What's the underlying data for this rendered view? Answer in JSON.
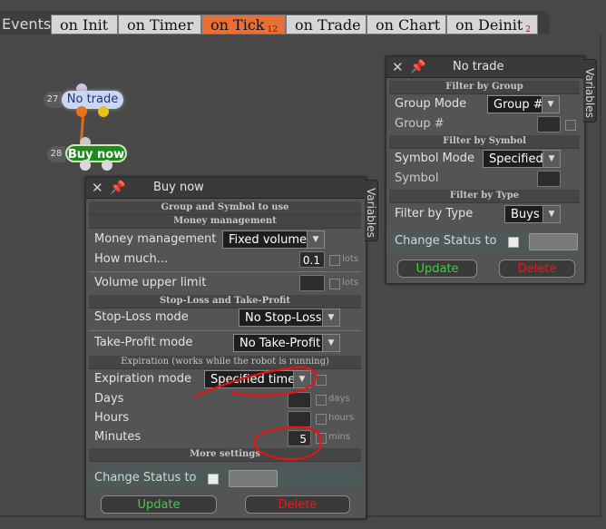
{
  "tabs": {
    "events_label": "Events",
    "items": [
      {
        "label": "on Init",
        "badge": ""
      },
      {
        "label": "on Timer",
        "badge": ""
      },
      {
        "label": "on Tick",
        "badge": "12"
      },
      {
        "label": "on Trade",
        "badge": ""
      },
      {
        "label": "on Chart",
        "badge": ""
      },
      {
        "label": "on Deinit",
        "badge": "2"
      }
    ],
    "active": "on Tick"
  },
  "nodes": [
    {
      "id": "27",
      "label": "No trade"
    },
    {
      "id": "28",
      "label": "Buy now"
    }
  ],
  "buy_panel": {
    "title": "Buy now",
    "variables_tab": "Variables",
    "group_symbol_header": "Group and Symbol to use",
    "money_header": "Money management",
    "money_mode_label": "Money management",
    "money_mode_value": "Fixed volume",
    "how_much_label": "How much...",
    "how_much_value": "0.1",
    "how_much_unit": "lots",
    "vol_upper_label": "Volume upper limit",
    "vol_upper_value": "",
    "vol_upper_unit": "lots",
    "sltp_header": "Stop-Loss and Take-Profit",
    "sl_label": "Stop-Loss mode",
    "sl_value": "No Stop-Loss",
    "tp_label": "Take-Profit mode",
    "tp_value": "No Take-Profit",
    "exp_header": "Expiration (works while the robot is running)",
    "exp_mode_label": "Expiration mode",
    "exp_mode_value": "Specified time",
    "days_label": "Days",
    "days_value": "",
    "days_unit": "days",
    "hours_label": "Hours",
    "hours_value": "",
    "hours_unit": "hours",
    "minutes_label": "Minutes",
    "minutes_value": "5",
    "minutes_unit": "mins",
    "more_header": "More settings",
    "change_status_label": "Change Status to",
    "change_status_value": "",
    "update_label": "Update",
    "delete_label": "Delete"
  },
  "notrade_panel": {
    "title": "No trade",
    "variables_tab": "Variables",
    "filter_group_header": "Filter by Group",
    "group_mode_label": "Group Mode",
    "group_mode_value": "Group #",
    "group_num_label": "Group #",
    "group_num_value": "",
    "filter_symbol_header": "Filter by Symbol",
    "symbol_mode_label": "Symbol Mode",
    "symbol_mode_value": "Specified",
    "symbol_label": "Symbol",
    "symbol_value": "",
    "filter_type_header": "Filter by Type",
    "filter_type_label": "Filter by Type",
    "filter_type_value": "Buys",
    "change_status_label": "Change Status to",
    "change_status_value": "",
    "update_label": "Update",
    "delete_label": "Delete"
  },
  "colors": {
    "active_tab": "#e87037",
    "annotation": "#e81414",
    "update_text": "#3ed03e",
    "delete_text": "#e61a1a",
    "wire": "#e06a12"
  }
}
